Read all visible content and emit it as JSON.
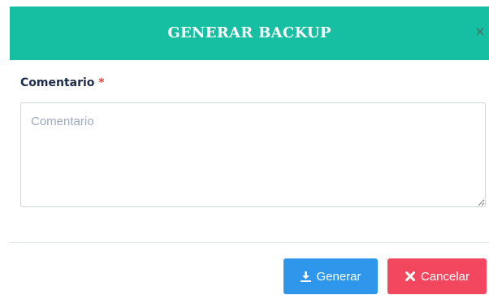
{
  "modal": {
    "title": "GENERAR BACKUP",
    "close_symbol": "×",
    "close_icon": "close-icon"
  },
  "form": {
    "comment_label": "Comentario",
    "required_mark": "*",
    "comment_placeholder": "Comentario",
    "comment_value": ""
  },
  "footer": {
    "generate_label": "Generar",
    "generate_icon": "download-icon",
    "cancel_label": "Cancelar",
    "cancel_icon": "x-icon"
  },
  "colors": {
    "header_bg": "#17bfa2",
    "generate_bg": "#2f97eb",
    "cancel_bg": "#f2475f",
    "required": "#e2443c"
  }
}
